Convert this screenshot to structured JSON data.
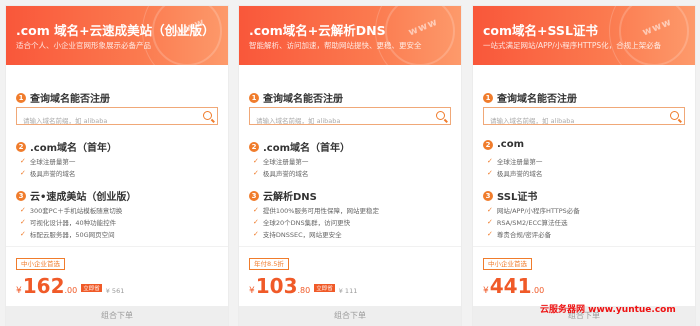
{
  "cards": [
    {
      "title": ".com 域名+云速成美站（创业版）",
      "subtitle": "适合个人、小企业官网形象展示必备产品",
      "watermark": "www",
      "s1_label": "查询域名能否注册",
      "search_placeholder": "请输入域名前缀，如 alibaba",
      "s2_label": ".com域名（首年）",
      "s2_feats": [
        "全球注册量第一",
        "极具声誉的域名"
      ],
      "s3_label": "云•速成美站（创业版）",
      "s3_feats": [
        "300套PC＋手机站模板随意切换",
        "可视化设计器，40种功能控件",
        "标配云服务器，50G网页空间"
      ],
      "badge": "中小企业首选",
      "price_currency": "¥",
      "price_int": "162",
      "price_dec": ".00",
      "price_tag": "立即省",
      "orig_price": "¥ 561",
      "buy_label": "组合下单"
    },
    {
      "title": ".com域名+云解析DNS",
      "subtitle": "智能解析、访问加速，帮助网站提快、更稳、更安全",
      "watermark": "www",
      "s1_label": "查询域名能否注册",
      "search_placeholder": "请输入域名前缀，如 alibaba",
      "s2_label": ".com域名（首年）",
      "s2_feats": [
        "全球注册量第一",
        "极具声誉的域名"
      ],
      "s3_label": "云解析DNS",
      "s3_feats": [
        "提供100%服务可用性保障，网站更稳定",
        "全球20个DNS集群，访问更快",
        "支持DNSSEC，网站更安全"
      ],
      "badge": "年付8.5折",
      "price_currency": "¥",
      "price_int": "103",
      "price_dec": ".80",
      "price_tag": "立即省",
      "orig_price": "¥ 111",
      "buy_label": "组合下单"
    },
    {
      "title": "com域名+SSL证书",
      "subtitle": "一站式满足网站/APP/小程序HTTPS化，合规上架必备",
      "watermark": "www",
      "s1_label": "查询域名能否注册",
      "search_placeholder": "请输入域名前缀，如 alibaba",
      "s2_label": ".com",
      "s2_feats": [
        "全球注册量第一",
        "极具声誉的域名"
      ],
      "s3_label": "SSL证书",
      "s3_feats": [
        "网站/APP/小程序HTTPS必备",
        "RSA/SM2/ECC算法任选",
        "尊贵合规/密评必备"
      ],
      "badge": "中小企业首选",
      "price_currency": "¥",
      "price_int": "441",
      "price_dec": ".00",
      "price_tag": "",
      "orig_price": "",
      "buy_label": "组合下单"
    }
  ],
  "site_watermark": "云服务器网 www.yuntue.com",
  "colors": {
    "accent": "#f07c2c",
    "price": "#f05a28",
    "header_start": "#f9573a",
    "header_end": "#fd9a6b"
  }
}
